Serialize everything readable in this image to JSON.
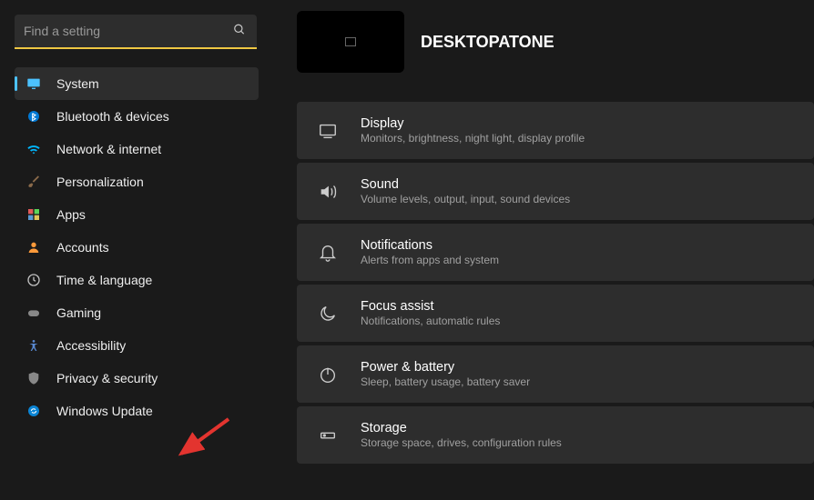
{
  "search": {
    "placeholder": "Find a setting"
  },
  "device": {
    "name": "DESKTOPATONE"
  },
  "nav": [
    {
      "label": "System",
      "icon": "monitor-icon",
      "color": "#4cc2ff",
      "active": true
    },
    {
      "label": "Bluetooth & devices",
      "icon": "bluetooth-icon",
      "color": "#0078d4"
    },
    {
      "label": "Network & internet",
      "icon": "wifi-icon",
      "color": "#00b7ff"
    },
    {
      "label": "Personalization",
      "icon": "brush-icon",
      "color": "#8a6a4a"
    },
    {
      "label": "Apps",
      "icon": "apps-icon",
      "color": "#e15a5a"
    },
    {
      "label": "Accounts",
      "icon": "person-icon",
      "color": "#ff9a3a"
    },
    {
      "label": "Time & language",
      "icon": "clock-globe-icon",
      "color": "#c0c0c0"
    },
    {
      "label": "Gaming",
      "icon": "gaming-icon",
      "color": "#888888"
    },
    {
      "label": "Accessibility",
      "icon": "accessibility-icon",
      "color": "#5a8ad4"
    },
    {
      "label": "Privacy & security",
      "icon": "shield-icon",
      "color": "#888888"
    },
    {
      "label": "Windows Update",
      "icon": "update-icon",
      "color": "#0a84d4"
    }
  ],
  "cards": [
    {
      "title": "Display",
      "desc": "Monitors, brightness, night light, display profile",
      "icon": "display-icon"
    },
    {
      "title": "Sound",
      "desc": "Volume levels, output, input, sound devices",
      "icon": "sound-icon"
    },
    {
      "title": "Notifications",
      "desc": "Alerts from apps and system",
      "icon": "bell-icon"
    },
    {
      "title": "Focus assist",
      "desc": "Notifications, automatic rules",
      "icon": "moon-icon"
    },
    {
      "title": "Power & battery",
      "desc": "Sleep, battery usage, battery saver",
      "icon": "power-icon"
    },
    {
      "title": "Storage",
      "desc": "Storage space, drives, configuration rules",
      "icon": "storage-icon"
    }
  ]
}
